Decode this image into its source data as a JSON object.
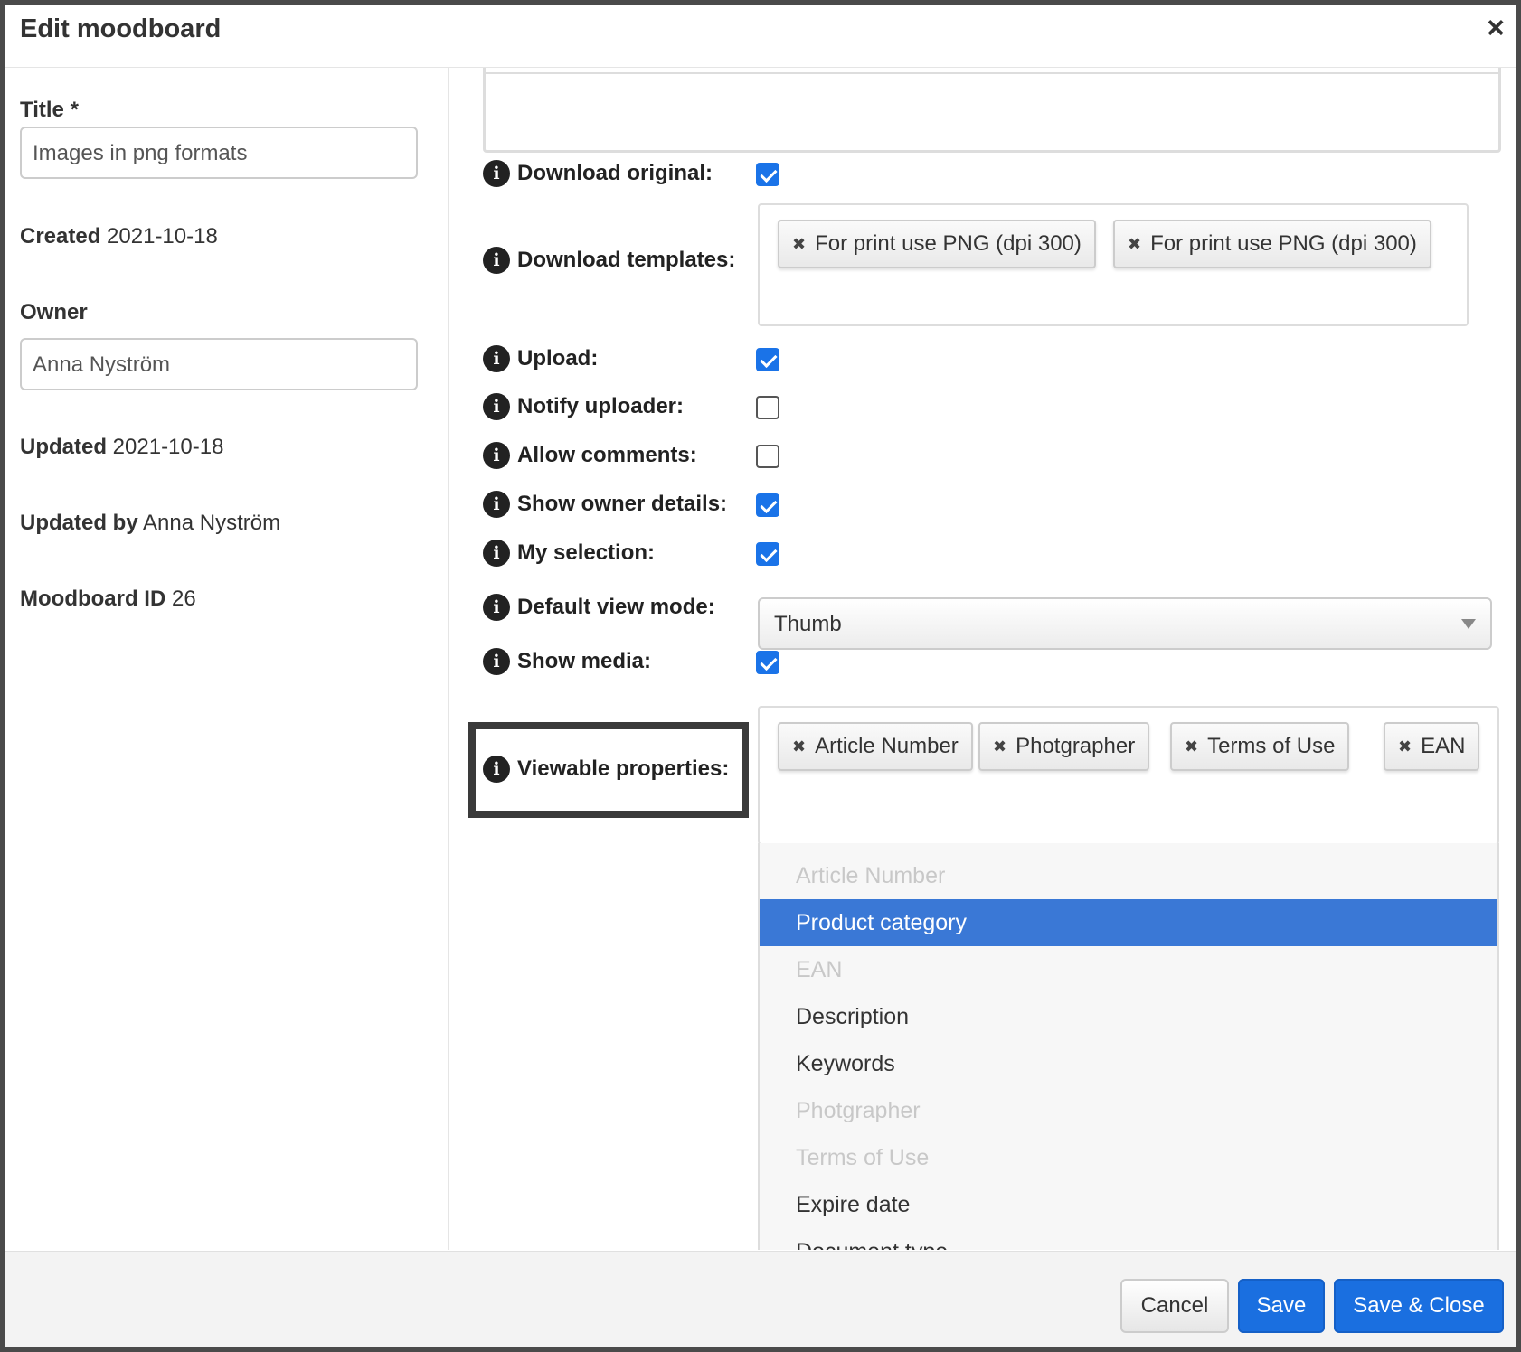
{
  "dialog": {
    "title": "Edit moodboard",
    "close_symbol": "×"
  },
  "left": {
    "title_label": "Title *",
    "title_value": "Images in png formats",
    "created_label": "Created",
    "created_value": "2021-10-18",
    "owner_label": "Owner",
    "owner_value": "Anna Nyström",
    "updated_label": "Updated",
    "updated_value": "2021-10-18",
    "updated_by_label": "Updated by",
    "updated_by_value": "Anna Nyström",
    "moodboard_id_label": "Moodboard ID",
    "moodboard_id_value": "26"
  },
  "settings": {
    "download_original": {
      "label": "Download original:",
      "checked": true
    },
    "download_templates": {
      "label": "Download templates:",
      "tags": [
        "For print use PNG (dpi 300)",
        "For print use PNG (dpi 300)"
      ]
    },
    "upload": {
      "label": "Upload:",
      "checked": true
    },
    "notify_uploader": {
      "label": "Notify uploader:",
      "checked": false
    },
    "allow_comments": {
      "label": "Allow comments:",
      "checked": false
    },
    "show_owner_details": {
      "label": "Show owner details:",
      "checked": true
    },
    "my_selection": {
      "label": "My selection:",
      "checked": true
    },
    "default_view_mode": {
      "label": "Default view mode:",
      "value": "Thumb"
    },
    "show_media": {
      "label": "Show media:",
      "checked": true
    },
    "viewable_properties": {
      "label": "Viewable properties:",
      "tags": [
        "Article Number",
        "Photgrapher",
        "Terms of Use",
        "EAN"
      ],
      "options": [
        {
          "label": "Article Number",
          "state": "disabled"
        },
        {
          "label": "Product category",
          "state": "highlighted"
        },
        {
          "label": "EAN",
          "state": "disabled"
        },
        {
          "label": "Description",
          "state": "normal"
        },
        {
          "label": "Keywords",
          "state": "normal"
        },
        {
          "label": "Photgrapher",
          "state": "disabled"
        },
        {
          "label": "Terms of Use",
          "state": "disabled"
        },
        {
          "label": "Expire date",
          "state": "normal"
        },
        {
          "label": "Document type",
          "state": "normal"
        }
      ]
    }
  },
  "tag_remove_symbol": "✖",
  "info_symbol": "i",
  "footer": {
    "cancel": "Cancel",
    "save": "Save",
    "save_close": "Save & Close"
  },
  "colors": {
    "primary": "#1a6fe0",
    "checkbox": "#1a73e8",
    "highlight": "#3a78d6"
  }
}
